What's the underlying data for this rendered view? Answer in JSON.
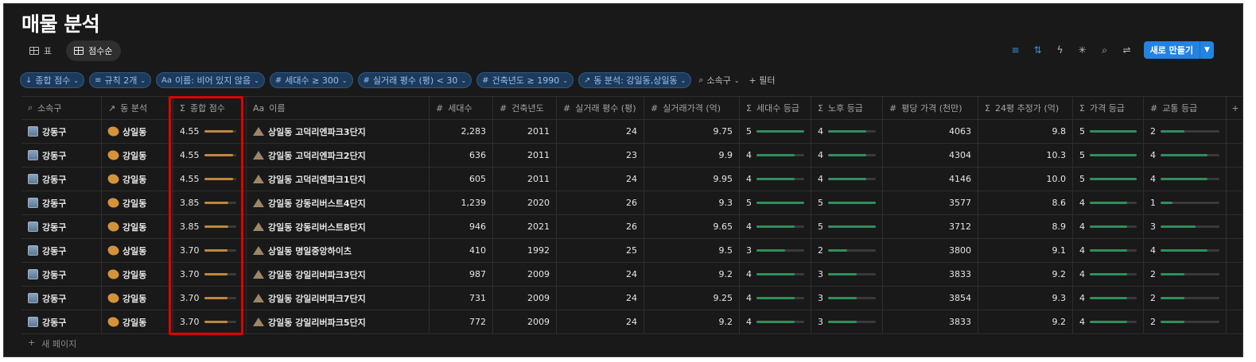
{
  "title": "매물 분석",
  "view_tabs": [
    {
      "label": "표",
      "active": false
    },
    {
      "label": "점수순",
      "active": true
    }
  ],
  "toolbar": {
    "new_label": "새로 만들기"
  },
  "filters": [
    {
      "icon": "↓",
      "label": "종합 점수"
    },
    {
      "icon": "≡",
      "label": "규칙 2개"
    },
    {
      "icon": "Aa",
      "label": "이름: 비어 있지 않음"
    },
    {
      "icon": "#",
      "label": "세대수 ≥ 300"
    },
    {
      "icon": "#",
      "label": "실거래 평수 (평) < 30"
    },
    {
      "icon": "#",
      "label": "건축년도 ≥ 1990"
    },
    {
      "icon": "↗",
      "label": "동 분석: 강일동,상일동"
    }
  ],
  "filter_extra": {
    "sgu": "소속구",
    "add_filter": "+ 필터"
  },
  "columns": {
    "sgu": "소속구",
    "dong": "동 분석",
    "score": "종합 점수",
    "name": "이름",
    "sede": "세대수",
    "year": "건축년도",
    "area": "실거래 평수 (평)",
    "price": "실거래가격 (억)",
    "sede_grade": "세대수 등급",
    "age_grade": "노후 등급",
    "ppyeong": "평당 가격 (천만)",
    "est24": "24평 추정가 (억)",
    "price_grade": "가격 등급",
    "traffic_grade": "교통 등급"
  },
  "rows": [
    {
      "sgu": "강동구",
      "dong": "상일동",
      "score": "4.55",
      "score_frac": 0.91,
      "name": "상일동 고덕리엔파크3단지",
      "sede": "2,283",
      "year": "2011",
      "area": "24",
      "price": "9.75",
      "sede_grade": "5",
      "sede_frac": 1.0,
      "age_grade": "4",
      "age_frac": 0.8,
      "ppyeong": "4063",
      "est24": "9.8",
      "price_grade": "5",
      "price_frac": 1.0,
      "traffic_grade": "2",
      "traffic_frac": 0.4
    },
    {
      "sgu": "강동구",
      "dong": "강일동",
      "score": "4.55",
      "score_frac": 0.91,
      "name": "강일동 고덕리엔파크2단지",
      "sede": "636",
      "year": "2011",
      "area": "23",
      "price": "9.9",
      "sede_grade": "4",
      "sede_frac": 0.8,
      "age_grade": "4",
      "age_frac": 0.8,
      "ppyeong": "4304",
      "est24": "10.3",
      "price_grade": "5",
      "price_frac": 1.0,
      "traffic_grade": "4",
      "traffic_frac": 0.8
    },
    {
      "sgu": "강동구",
      "dong": "강일동",
      "score": "4.55",
      "score_frac": 0.91,
      "name": "강일동 고덕리엔파크1단지",
      "sede": "605",
      "year": "2011",
      "area": "24",
      "price": "9.95",
      "sede_grade": "4",
      "sede_frac": 0.8,
      "age_grade": "4",
      "age_frac": 0.8,
      "ppyeong": "4146",
      "est24": "10.0",
      "price_grade": "5",
      "price_frac": 1.0,
      "traffic_grade": "4",
      "traffic_frac": 0.8
    },
    {
      "sgu": "강동구",
      "dong": "강일동",
      "score": "3.85",
      "score_frac": 0.77,
      "name": "강일동 강동리버스트4단지",
      "sede": "1,239",
      "year": "2020",
      "area": "26",
      "price": "9.3",
      "sede_grade": "5",
      "sede_frac": 1.0,
      "age_grade": "5",
      "age_frac": 1.0,
      "ppyeong": "3577",
      "est24": "8.6",
      "price_grade": "4",
      "price_frac": 0.8,
      "traffic_grade": "1",
      "traffic_frac": 0.2
    },
    {
      "sgu": "강동구",
      "dong": "강일동",
      "score": "3.85",
      "score_frac": 0.77,
      "name": "강일동 강동리버스트8단지",
      "sede": "946",
      "year": "2021",
      "area": "26",
      "price": "9.65",
      "sede_grade": "4",
      "sede_frac": 0.8,
      "age_grade": "5",
      "age_frac": 1.0,
      "ppyeong": "3712",
      "est24": "8.9",
      "price_grade": "4",
      "price_frac": 0.8,
      "traffic_grade": "3",
      "traffic_frac": 0.6
    },
    {
      "sgu": "강동구",
      "dong": "상일동",
      "score": "3.70",
      "score_frac": 0.74,
      "name": "상일동 명일중앙하이츠",
      "sede": "410",
      "year": "1992",
      "area": "25",
      "price": "9.5",
      "sede_grade": "3",
      "sede_frac": 0.6,
      "age_grade": "2",
      "age_frac": 0.4,
      "ppyeong": "3800",
      "est24": "9.1",
      "price_grade": "4",
      "price_frac": 0.8,
      "traffic_grade": "4",
      "traffic_frac": 0.8
    },
    {
      "sgu": "강동구",
      "dong": "강일동",
      "score": "3.70",
      "score_frac": 0.74,
      "name": "강일동 강일리버파크3단지",
      "sede": "987",
      "year": "2009",
      "area": "24",
      "price": "9.2",
      "sede_grade": "4",
      "sede_frac": 0.8,
      "age_grade": "3",
      "age_frac": 0.6,
      "ppyeong": "3833",
      "est24": "9.2",
      "price_grade": "4",
      "price_frac": 0.8,
      "traffic_grade": "2",
      "traffic_frac": 0.4
    },
    {
      "sgu": "강동구",
      "dong": "강일동",
      "score": "3.70",
      "score_frac": 0.74,
      "name": "강일동 강일리버파크7단지",
      "sede": "731",
      "year": "2009",
      "area": "24",
      "price": "9.25",
      "sede_grade": "4",
      "sede_frac": 0.8,
      "age_grade": "3",
      "age_frac": 0.6,
      "ppyeong": "3854",
      "est24": "9.3",
      "price_grade": "4",
      "price_frac": 0.8,
      "traffic_grade": "2",
      "traffic_frac": 0.4
    },
    {
      "sgu": "강동구",
      "dong": "강일동",
      "score": "3.70",
      "score_frac": 0.74,
      "name": "강일동 강일리버파크5단지",
      "sede": "772",
      "year": "2009",
      "area": "24",
      "price": "9.2",
      "sede_grade": "4",
      "sede_frac": 0.8,
      "age_grade": "3",
      "age_frac": 0.6,
      "ppyeong": "3833",
      "est24": "9.2",
      "price_grade": "4",
      "price_frac": 0.8,
      "traffic_grade": "2",
      "traffic_frac": 0.4
    }
  ],
  "footer": {
    "new_page": "새 페이지"
  }
}
